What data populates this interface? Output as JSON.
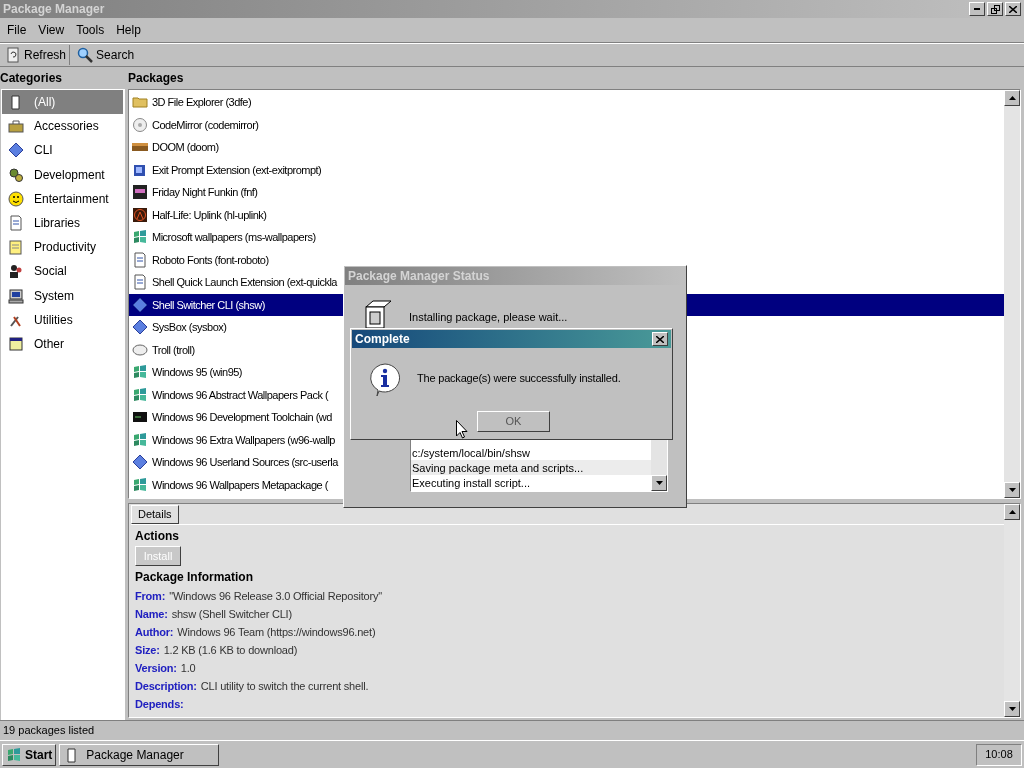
{
  "window": {
    "title": "Package Manager",
    "active": false
  },
  "menu": [
    "File",
    "View",
    "Tools",
    "Help"
  ],
  "toolbar": [
    "Refresh",
    "Search"
  ],
  "categories": {
    "title": "Categories",
    "items": [
      {
        "label": "(All)",
        "selected": true
      },
      {
        "label": "Accessories",
        "selected": false
      },
      {
        "label": "CLI",
        "selected": false
      },
      {
        "label": "Development",
        "selected": false
      },
      {
        "label": "Entertainment",
        "selected": false
      },
      {
        "label": "Libraries",
        "selected": false
      },
      {
        "label": "Productivity",
        "selected": false
      },
      {
        "label": "Social",
        "selected": false
      },
      {
        "label": "System",
        "selected": false
      },
      {
        "label": "Utilities",
        "selected": false
      },
      {
        "label": "Other",
        "selected": false
      }
    ]
  },
  "packages": {
    "title": "Packages",
    "items": [
      {
        "label": "3D File Explorer (3dfe)",
        "selected": false
      },
      {
        "label": "CodeMirror (codemirror)",
        "selected": false
      },
      {
        "label": "DOOM (doom)",
        "selected": false
      },
      {
        "label": "Exit Prompt Extension (ext-exitprompt)",
        "selected": false
      },
      {
        "label": "Friday Night Funkin (fnf)",
        "selected": false
      },
      {
        "label": "Half-Life: Uplink (hl-uplink)",
        "selected": false
      },
      {
        "label": "Microsoft wallpapers (ms-wallpapers)",
        "selected": false
      },
      {
        "label": "Roboto Fonts (font-roboto)",
        "selected": false
      },
      {
        "label": "Shell Quick Launch Extension (ext-quickla",
        "selected": false
      },
      {
        "label": "Shell Switcher CLI (shsw)",
        "selected": true
      },
      {
        "label": "SysBox (sysbox)",
        "selected": false
      },
      {
        "label": "Troll (troll)",
        "selected": false
      },
      {
        "label": "Windows 95 (win95)",
        "selected": false
      },
      {
        "label": "Windows 96 Abstract Wallpapers Pack (",
        "selected": false
      },
      {
        "label": "Windows 96 Development Toolchain (wd",
        "selected": false
      },
      {
        "label": "Windows 96 Extra Wallpapers (w96-wallp",
        "selected": false
      },
      {
        "label": "Windows 96 Userland Sources (src-userla",
        "selected": false
      },
      {
        "label": "Windows 96 Wallpapers Metapackage (",
        "selected": false
      }
    ]
  },
  "details": {
    "tab": "Details",
    "actions_title": "Actions",
    "install_button": {
      "label": "Install",
      "disabled": true
    },
    "info_title": "Package Information",
    "fields": [
      {
        "label": "From:",
        "value": "\"Windows 96 Release 3.0 Official Repository\""
      },
      {
        "label": "Name:",
        "value": "shsw (Shell Switcher CLI)"
      },
      {
        "label": "Author:",
        "value": "Windows 96 Team (https://windows96.net)"
      },
      {
        "label": "Size:",
        "value": "1.2 KB (1.6 KB to download)"
      },
      {
        "label": "Version:",
        "value": "1.0"
      },
      {
        "label": "Description:",
        "value": "CLI utility to switch the current shell."
      },
      {
        "label": "Depends:"
      }
    ]
  },
  "status_bar": "19 packages listed",
  "status_dialog": {
    "title": "Package Manager Status",
    "active": false,
    "message": "Installing package, please wait...",
    "log": [
      "c:/system/local/bin/shsw",
      "Saving package meta and scripts...",
      "Executing install script..."
    ]
  },
  "alert": {
    "title": "Complete",
    "active": true,
    "message": "The package(s) were successfully installed.",
    "button": "OK"
  },
  "taskbar": {
    "start": "Start",
    "tasks": [
      {
        "label": "Package Manager",
        "selected": false
      }
    ],
    "clock": "10:08"
  }
}
